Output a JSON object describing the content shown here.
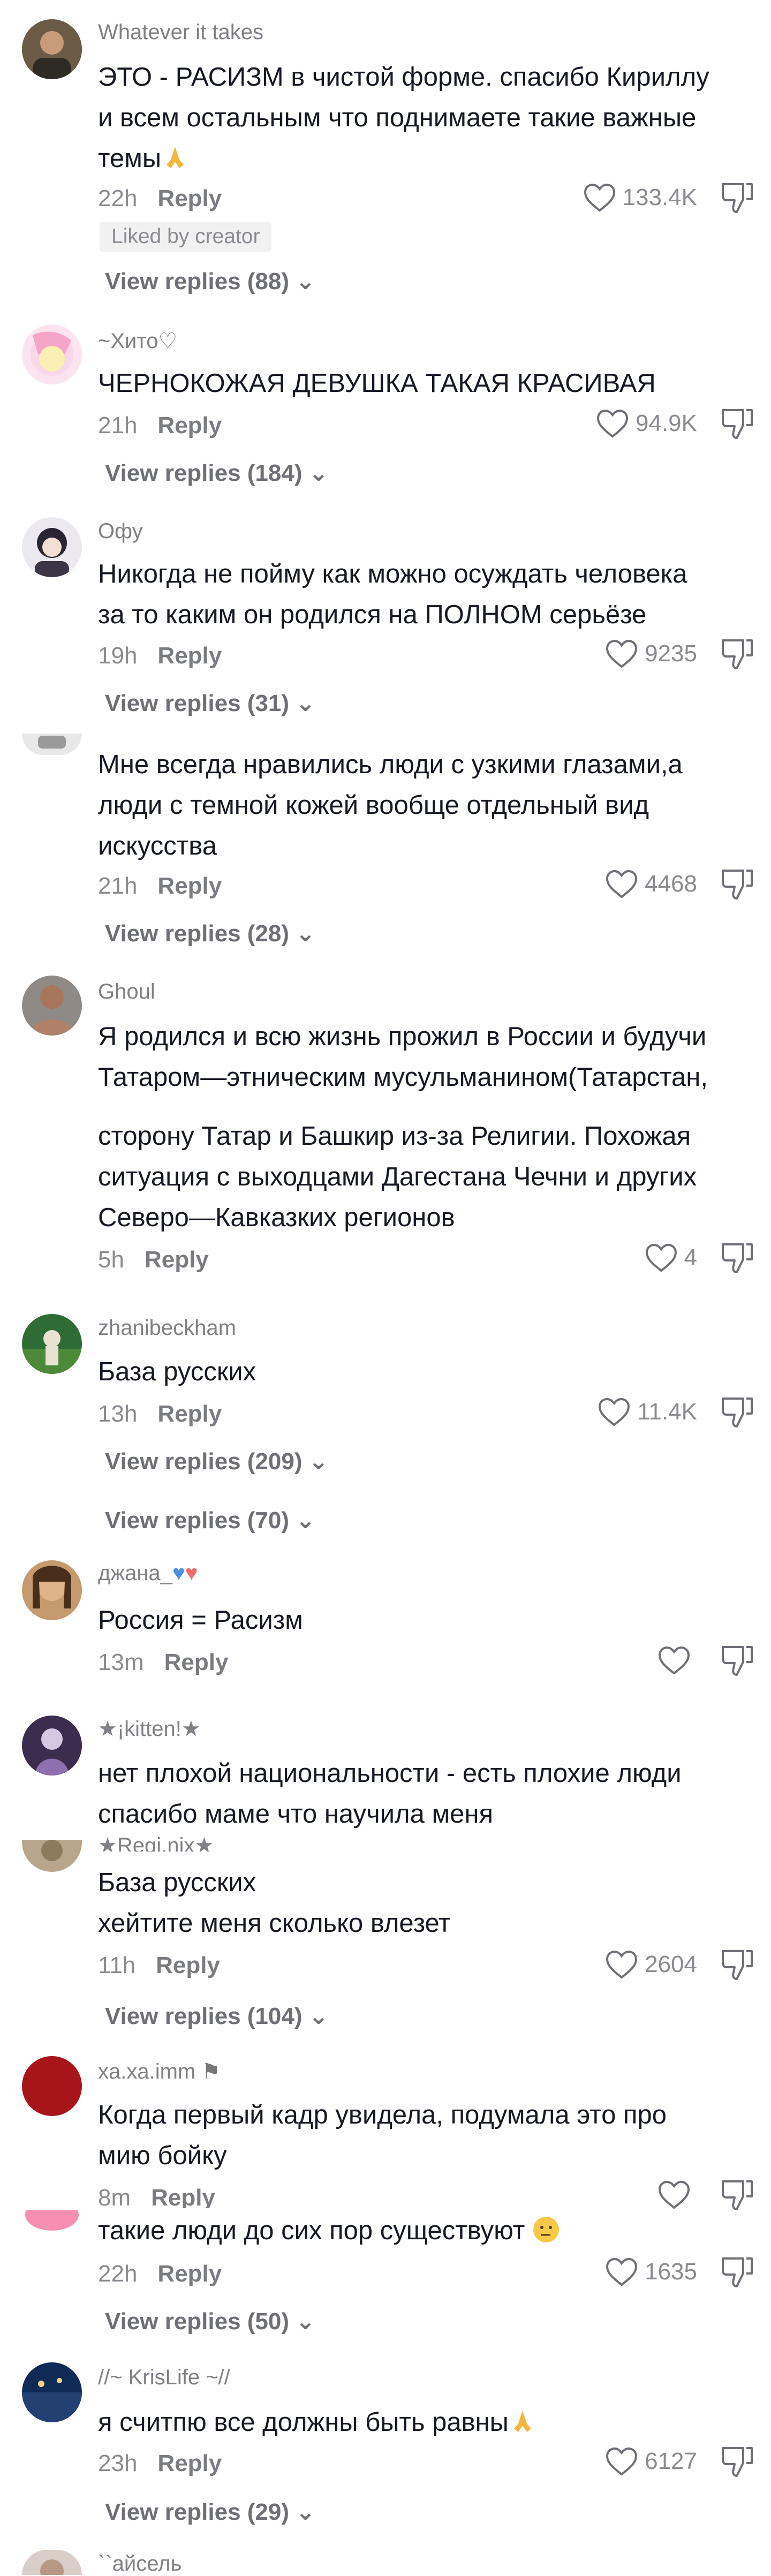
{
  "comments": [
    {
      "user": "Whatever it takes",
      "text": "ЭТО - РАСИЗМ в чистой форме. спасибо Кириллу\nи всем остальным что поднимаете такие важные\nтемы",
      "time": "22h",
      "reply": "Reply",
      "likes": "133.4K",
      "badge": "Liked by creator",
      "view_replies": "View replies (88)"
    },
    {
      "user": "~Хито♡",
      "text": "ЧЕРНОКОЖАЯ ДЕВУШКА ТАКАЯ КРАСИВАЯ",
      "time": "21h",
      "reply": "Reply",
      "likes": "94.9K",
      "view_replies": "View replies (184)"
    },
    {
      "user": "Офу",
      "text": "Никогда не пойму как можно осуждать человека\nза то каким он родился на ПОЛНОМ серьёзе",
      "time": "19h",
      "reply": "Reply",
      "likes": "9235",
      "view_replies": "View replies (31)"
    },
    {
      "text": "Мне всегда нравились люди с узкими глазами,а\nлюди с темной кожей вообще отдельный вид\nискусства",
      "time": "21h",
      "reply": "Reply",
      "likes": "4468",
      "view_replies": "View replies (28)"
    },
    {
      "user": "Ghoul",
      "text": "Я родился и всю жизнь прожил в России и будучи\nТатаром—этническим мусульманином(Татарстан,",
      "text2": "сторону Татар и Башкир из-за Религии. Похожая\nситуация с выходцами Дагестана Чечни и других\nСеверо—Кавказких регионов",
      "time": "5h",
      "reply": "Reply",
      "likes": "4"
    },
    {
      "user": "zhanibeckham",
      "text": "База русских",
      "time": "13h",
      "reply": "Reply",
      "likes": "11.4K",
      "view_replies": "View replies (209)",
      "view_replies_2": "View replies (70)"
    },
    {
      "user": "джана_",
      "text": "Россия = Расизм",
      "time": "13m",
      "reply": "Reply",
      "likes": ""
    },
    {
      "user": "★¡kitten!★",
      "text": "нет плохой национальности - есть плохие люди\nспасибо маме что научила меня"
    },
    {
      "user": "★Regi.nix★",
      "text": "База русских\nхейтите меня сколько влезет",
      "time": "11h",
      "reply": "Reply",
      "likes": "2604",
      "view_replies": "View replies (104)"
    },
    {
      "user": "xa.xa.imm",
      "text": "Когда первый кадр увидела, подумала это про\nмию бойку",
      "time": "8m",
      "reply": "Reply",
      "likes": ""
    },
    {
      "text": "такие люди до сих пор существуют",
      "time": "22h",
      "reply": "Reply",
      "likes": "1635",
      "view_replies": "View replies (50)"
    },
    {
      "user": "//~ KrisLife ~//",
      "text": "я считпю все должны быть равны",
      "time": "23h",
      "reply": "Reply",
      "likes": "6127",
      "view_replies": "View replies (29)"
    },
    {
      "user": "``айсель"
    }
  ],
  "colors": {
    "text": "#161823",
    "muted": "#8a8b91",
    "badge_bg": "#f1f1f2"
  }
}
